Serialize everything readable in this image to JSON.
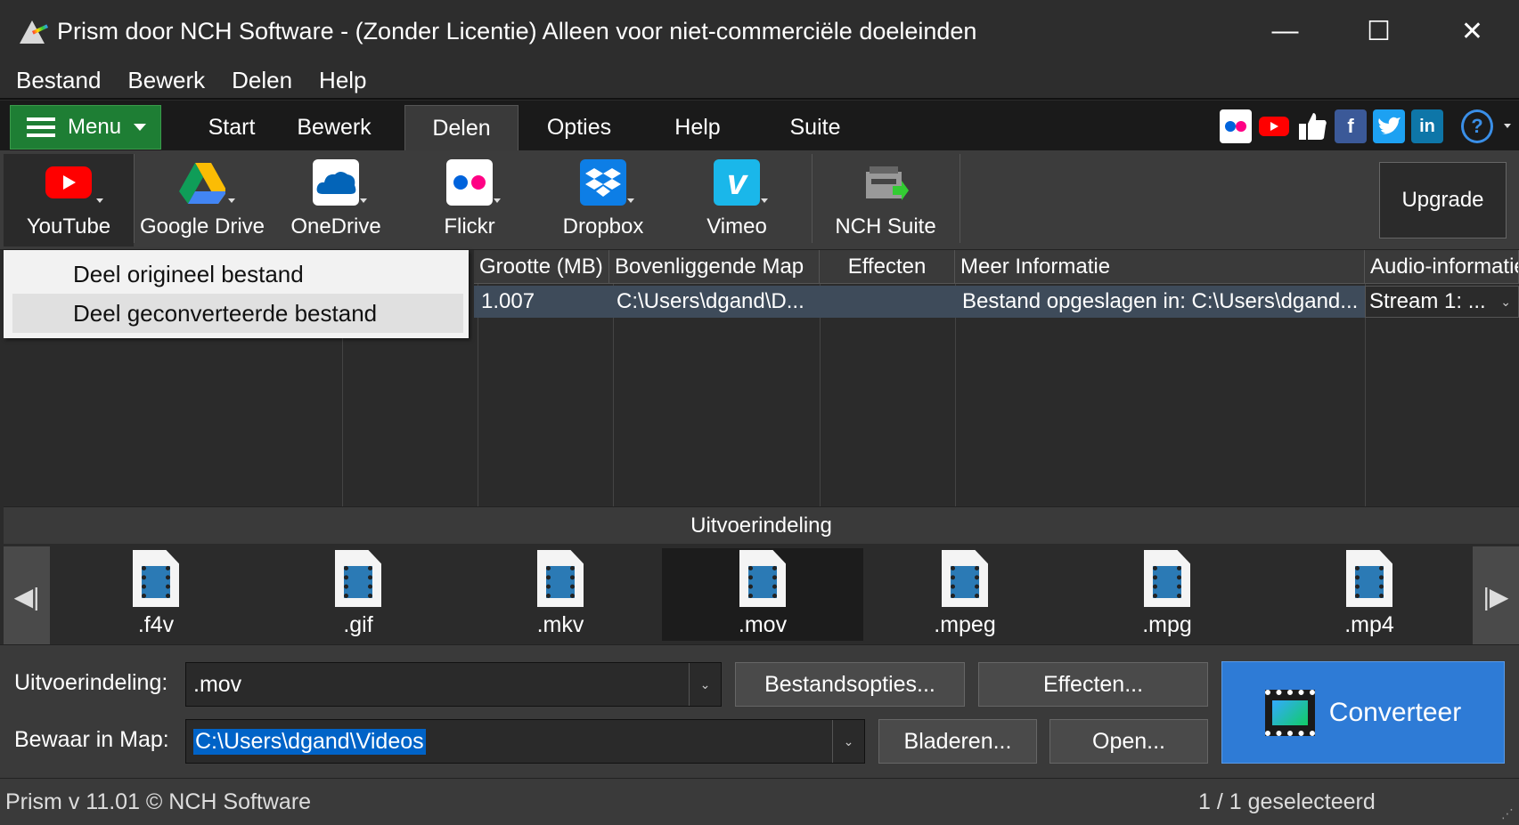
{
  "window": {
    "title": "Prism door NCH Software - (Zonder Licentie) Alleen voor niet-commerciële doeleinden",
    "minimize": "—",
    "maximize": "☐",
    "close": "✕"
  },
  "menubar": [
    "Bestand",
    "Bewerk",
    "Delen",
    "Help"
  ],
  "tabs": {
    "menu_label": "Menu",
    "items": [
      "Start",
      "Bewerk",
      "Delen",
      "Opties",
      "Help",
      "Suite"
    ],
    "active": "Delen"
  },
  "social_icons": [
    "flickr-icon",
    "youtube-icon",
    "like-icon",
    "facebook-icon",
    "twitter-icon",
    "linkedin-icon",
    "help-icon"
  ],
  "ribbon": {
    "buttons": [
      {
        "label": "YouTube",
        "icon": "youtube-icon"
      },
      {
        "label": "Google Drive",
        "icon": "google-drive-icon"
      },
      {
        "label": "OneDrive",
        "icon": "onedrive-icon"
      },
      {
        "label": "Flickr",
        "icon": "flickr-icon"
      },
      {
        "label": "Dropbox",
        "icon": "dropbox-icon"
      },
      {
        "label": "Vimeo",
        "icon": "vimeo-icon"
      },
      {
        "label": "NCH Suite",
        "icon": "nch-suite-icon"
      }
    ],
    "upgrade": "Upgrade"
  },
  "share_menu": {
    "items": [
      "Deel origineel bestand",
      "Deel geconverteerde bestand"
    ]
  },
  "filelist": {
    "columns": [
      "Grootte (MB)",
      "Bovenliggende Map",
      "Effecten",
      "Meer Informatie",
      "Audio-informatie"
    ],
    "row": {
      "size": "1.007",
      "folder": "C:\\Users\\dgand\\D...",
      "effects": "",
      "info": "Bestand opgeslagen in: C:\\Users\\dgand...",
      "audio": "Stream 1: ..."
    }
  },
  "output": {
    "header": "Uitvoerindeling",
    "formats": [
      ".f4v",
      ".gif",
      ".mkv",
      ".mov",
      ".mpeg",
      ".mpg",
      ".mp4"
    ],
    "selected": ".mov"
  },
  "controls": {
    "format_label": "Uitvoerindeling:",
    "format_value": ".mov",
    "folder_label": "Bewaar in Map:",
    "folder_value": "C:\\Users\\dgand\\Videos",
    "file_options": "Bestandsopties...",
    "effects": "Effecten...",
    "browse": "Bladeren...",
    "open": "Open...",
    "convert": "Converteer"
  },
  "status": {
    "left": "Prism v 11.01 © NCH Software",
    "right": "1 / 1 geselecteerd"
  },
  "colors": {
    "menu_green": "#1e7e34",
    "convert_blue": "#2e7bd6",
    "selection_blue": "#0063c7"
  }
}
